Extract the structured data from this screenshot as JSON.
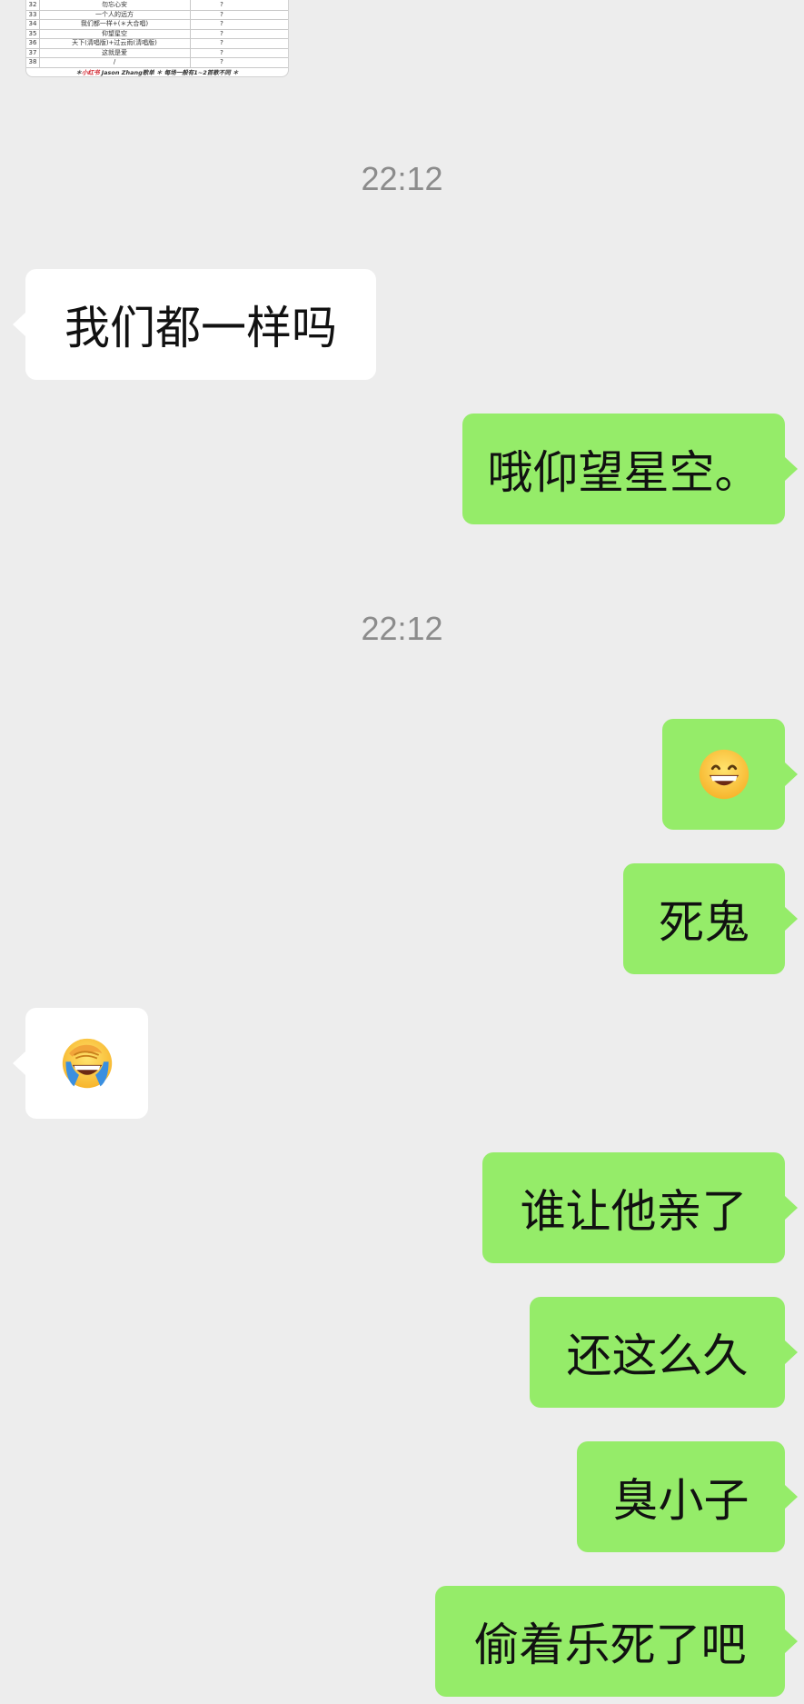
{
  "image_preview": {
    "rows": [
      {
        "num": "32",
        "song": "勿忘心安",
        "mark": "?"
      },
      {
        "num": "33",
        "song": "一个人的远方",
        "mark": "?"
      },
      {
        "num": "34",
        "song": "我们都一样+(＊大合唱)",
        "mark": "?"
      },
      {
        "num": "35",
        "song": "仰望星空",
        "mark": "?"
      },
      {
        "num": "36",
        "song": "天下(清唱版)+过云雨(清唱版)",
        "mark": "?"
      },
      {
        "num": "37",
        "song": "这就是爱",
        "mark": "?"
      },
      {
        "num": "38",
        "song": "/",
        "mark": "?"
      }
    ],
    "footer_prefix": "＊",
    "footer_red": "小红书",
    "footer_text": " Jason Zhang歌单 ＊ 每场一般有1~2首歌不同 ＊"
  },
  "messages": [
    {
      "type": "time",
      "text": "22:12"
    },
    {
      "type": "text",
      "side": "left",
      "text": "我们都一样吗"
    },
    {
      "type": "text",
      "side": "right",
      "text": "哦仰望星空。"
    },
    {
      "type": "time",
      "text": "22:12"
    },
    {
      "type": "emoji",
      "side": "right",
      "emoji": "grinning-face"
    },
    {
      "type": "text",
      "side": "right",
      "text": "死鬼"
    },
    {
      "type": "emoji",
      "side": "left",
      "emoji": "face-covering-laughing"
    },
    {
      "type": "text",
      "side": "right",
      "text": "谁让他亲了"
    },
    {
      "type": "text",
      "side": "right",
      "text": "还这么久"
    },
    {
      "type": "text",
      "side": "right",
      "text": "臭小子"
    },
    {
      "type": "text",
      "side": "right",
      "text": "偷着乐死了吧"
    }
  ],
  "colors": {
    "background": "#ededed",
    "outgoing_bubble": "#95ec69",
    "incoming_bubble": "#ffffff",
    "timestamp": "#8c8c8c"
  }
}
